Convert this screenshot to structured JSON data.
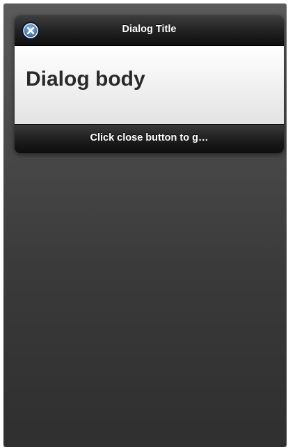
{
  "dialog": {
    "title": "Dialog Title",
    "close_icon": "close-icon",
    "body_text": "Dialog body",
    "footer_text": "Click close button to g…"
  },
  "colors": {
    "background_top": "#5b5b5b",
    "background_bottom": "#2f2f2f",
    "bar_dark": "#1c1c1c",
    "close_button_accent": "#4f86c6",
    "body_light": "#f1f1f1",
    "body_text": "#2a2a2a"
  }
}
